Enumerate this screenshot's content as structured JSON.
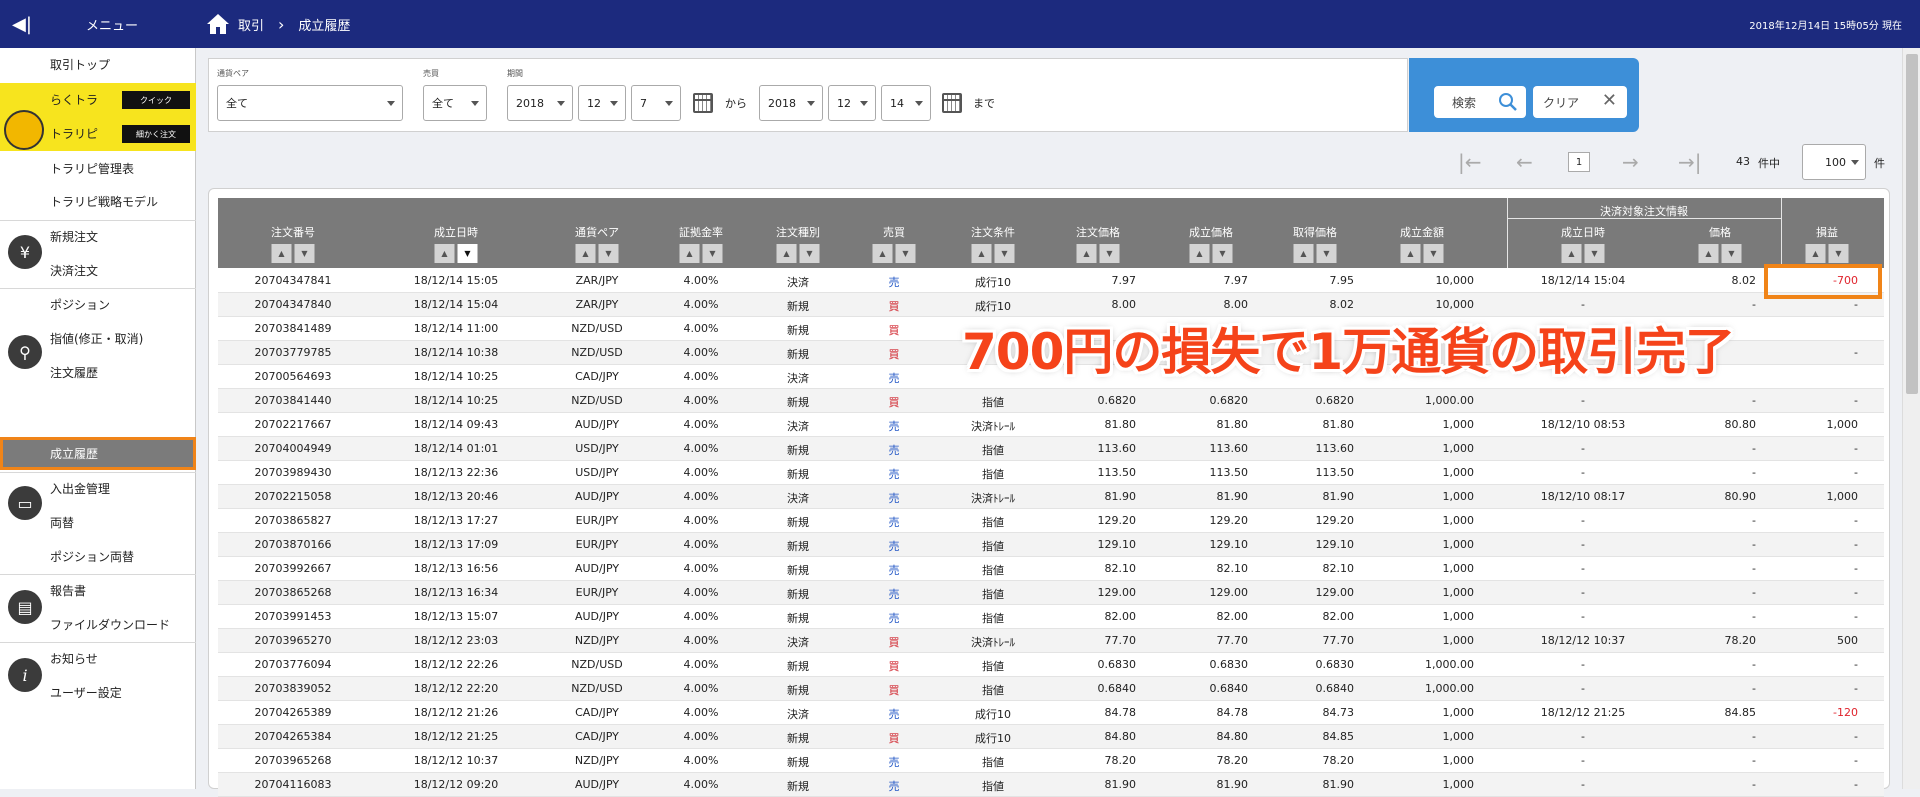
{
  "topbar": {
    "menu_label": "メニュー",
    "crumb_1": "取引",
    "crumb_2": "成立履歴",
    "datetime": "2018年12月14日 15時05分 現在"
  },
  "sidebar": {
    "top": "取引トップ",
    "rakutora": "らくトラ",
    "rakutora_badge": "クイック",
    "torarepi": "トラリピ",
    "torarepi_badge": "細かく注文",
    "torarepi_manage": "トラリピ管理表",
    "torarepi_strategy": "トラリピ戦略モデル",
    "new_order": "新規注文",
    "settle_order": "決済注文",
    "position": "ポジション",
    "limit_order": "指値(修正・取消)",
    "order_history": "注文履歴",
    "trade_history": "成立履歴",
    "deposit": "入出金管理",
    "exchange": "両替",
    "position_exchange": "ポジション両替",
    "report": "報告書",
    "download": "ファイルダウンロード",
    "notice": "お知らせ",
    "user_settings": "ユーザー設定"
  },
  "filter": {
    "pair_label": "通貨ペア",
    "pair_value": "全て",
    "side_label": "売買",
    "side_value": "全て",
    "period_label": "期間",
    "from_year": "2018",
    "from_month": "12",
    "from_day": "7",
    "from_text": "から",
    "to_year": "2018",
    "to_month": "12",
    "to_day": "14",
    "to_text": "まで",
    "search_label": "検索",
    "clear_label": "クリア"
  },
  "pager": {
    "page": "1",
    "count": "43",
    "count_suffix": "件中",
    "page_size": "100",
    "page_size_suffix": "件"
  },
  "table": {
    "group_header": "決済対象注文情報",
    "headers": {
      "order_no": "注文番号",
      "date": "成立日時",
      "pair": "通貨ペア",
      "margin": "証拠金率",
      "type": "注文種別",
      "side": "売買",
      "cond": "注文条件",
      "order_price": "注文価格",
      "exec_price": "成立価格",
      "fill_price": "取得価格",
      "amount": "成立金額",
      "settle_date": "成立日時",
      "settle_price": "価格",
      "pnl": "損益"
    },
    "rows": [
      {
        "no": "20704347841",
        "date": "18/12/14 15:05",
        "pair": "ZAR/JPY",
        "margin": "4.00%",
        "type": "決済",
        "side": "売",
        "cond": "成行10",
        "op": "7.97",
        "ep": "7.97",
        "fp": "7.95",
        "amt": "10,000",
        "sd": "18/12/14 15:04",
        "sp": "8.02",
        "pnl": "-700"
      },
      {
        "no": "20704347840",
        "date": "18/12/14 15:04",
        "pair": "ZAR/JPY",
        "margin": "4.00%",
        "type": "新規",
        "side": "買",
        "cond": "成行10",
        "op": "8.00",
        "ep": "8.00",
        "fp": "8.02",
        "amt": "10,000",
        "sd": "-",
        "sp": "-",
        "pnl": "-"
      },
      {
        "no": "20703841489",
        "date": "18/12/14 11:00",
        "pair": "NZD/USD",
        "margin": "4.00%",
        "type": "新規",
        "side": "買",
        "cond": "",
        "op": "",
        "ep": "",
        "fp": "",
        "amt": "",
        "sd": "",
        "sp": "",
        "pnl": ""
      },
      {
        "no": "20703779785",
        "date": "18/12/14 10:38",
        "pair": "NZD/USD",
        "margin": "4.00%",
        "type": "新規",
        "side": "買",
        "cond": "",
        "op": "",
        "ep": "",
        "fp": "",
        "amt": "",
        "sd": "",
        "sp": "",
        "pnl": "-"
      },
      {
        "no": "20700564693",
        "date": "18/12/14 10:25",
        "pair": "CAD/JPY",
        "margin": "4.00%",
        "type": "決済",
        "side": "売",
        "cond": "",
        "op": "",
        "ep": "",
        "fp": "",
        "amt": "",
        "sd": "",
        "sp": "",
        "pnl": ""
      },
      {
        "no": "20703841440",
        "date": "18/12/14 10:25",
        "pair": "NZD/USD",
        "margin": "4.00%",
        "type": "新規",
        "side": "買",
        "cond": "指値",
        "op": "0.6820",
        "ep": "0.6820",
        "fp": "0.6820",
        "amt": "1,000.00",
        "sd": "-",
        "sp": "-",
        "pnl": "-"
      },
      {
        "no": "20702217667",
        "date": "18/12/14 09:43",
        "pair": "AUD/JPY",
        "margin": "4.00%",
        "type": "決済",
        "side": "売",
        "cond": "決済ﾄﾚｰﾙ",
        "op": "81.80",
        "ep": "81.80",
        "fp": "81.80",
        "amt": "1,000",
        "sd": "18/12/10 08:53",
        "sp": "80.80",
        "pnl": "1,000"
      },
      {
        "no": "20704004949",
        "date": "18/12/14 01:01",
        "pair": "USD/JPY",
        "margin": "4.00%",
        "type": "新規",
        "side": "売",
        "cond": "指値",
        "op": "113.60",
        "ep": "113.60",
        "fp": "113.60",
        "amt": "1,000",
        "sd": "-",
        "sp": "-",
        "pnl": "-"
      },
      {
        "no": "20703989430",
        "date": "18/12/13 22:36",
        "pair": "USD/JPY",
        "margin": "4.00%",
        "type": "新規",
        "side": "売",
        "cond": "指値",
        "op": "113.50",
        "ep": "113.50",
        "fp": "113.50",
        "amt": "1,000",
        "sd": "-",
        "sp": "-",
        "pnl": "-"
      },
      {
        "no": "20702215058",
        "date": "18/12/13 20:46",
        "pair": "AUD/JPY",
        "margin": "4.00%",
        "type": "決済",
        "side": "売",
        "cond": "決済ﾄﾚｰﾙ",
        "op": "81.90",
        "ep": "81.90",
        "fp": "81.90",
        "amt": "1,000",
        "sd": "18/12/10 08:17",
        "sp": "80.90",
        "pnl": "1,000"
      },
      {
        "no": "20703865827",
        "date": "18/12/13 17:27",
        "pair": "EUR/JPY",
        "margin": "4.00%",
        "type": "新規",
        "side": "売",
        "cond": "指値",
        "op": "129.20",
        "ep": "129.20",
        "fp": "129.20",
        "amt": "1,000",
        "sd": "-",
        "sp": "-",
        "pnl": "-"
      },
      {
        "no": "20703870166",
        "date": "18/12/13 17:09",
        "pair": "EUR/JPY",
        "margin": "4.00%",
        "type": "新規",
        "side": "売",
        "cond": "指値",
        "op": "129.10",
        "ep": "129.10",
        "fp": "129.10",
        "amt": "1,000",
        "sd": "-",
        "sp": "-",
        "pnl": "-"
      },
      {
        "no": "20703992667",
        "date": "18/12/13 16:56",
        "pair": "AUD/JPY",
        "margin": "4.00%",
        "type": "新規",
        "side": "売",
        "cond": "指値",
        "op": "82.10",
        "ep": "82.10",
        "fp": "82.10",
        "amt": "1,000",
        "sd": "-",
        "sp": "-",
        "pnl": "-"
      },
      {
        "no": "20703865268",
        "date": "18/12/13 16:34",
        "pair": "EUR/JPY",
        "margin": "4.00%",
        "type": "新規",
        "side": "売",
        "cond": "指値",
        "op": "129.00",
        "ep": "129.00",
        "fp": "129.00",
        "amt": "1,000",
        "sd": "-",
        "sp": "-",
        "pnl": "-"
      },
      {
        "no": "20703991453",
        "date": "18/12/13 15:07",
        "pair": "AUD/JPY",
        "margin": "4.00%",
        "type": "新規",
        "side": "売",
        "cond": "指値",
        "op": "82.00",
        "ep": "82.00",
        "fp": "82.00",
        "amt": "1,000",
        "sd": "-",
        "sp": "-",
        "pnl": "-"
      },
      {
        "no": "20703965270",
        "date": "18/12/12 23:03",
        "pair": "NZD/JPY",
        "margin": "4.00%",
        "type": "決済",
        "side": "買",
        "cond": "決済ﾄﾚｰﾙ",
        "op": "77.70",
        "ep": "77.70",
        "fp": "77.70",
        "amt": "1,000",
        "sd": "18/12/12 10:37",
        "sp": "78.20",
        "pnl": "500"
      },
      {
        "no": "20703776094",
        "date": "18/12/12 22:26",
        "pair": "NZD/USD",
        "margin": "4.00%",
        "type": "新規",
        "side": "買",
        "cond": "指値",
        "op": "0.6830",
        "ep": "0.6830",
        "fp": "0.6830",
        "amt": "1,000.00",
        "sd": "-",
        "sp": "-",
        "pnl": "-"
      },
      {
        "no": "20703839052",
        "date": "18/12/12 22:20",
        "pair": "NZD/USD",
        "margin": "4.00%",
        "type": "新規",
        "side": "買",
        "cond": "指値",
        "op": "0.6840",
        "ep": "0.6840",
        "fp": "0.6840",
        "amt": "1,000.00",
        "sd": "-",
        "sp": "-",
        "pnl": "-"
      },
      {
        "no": "20704265389",
        "date": "18/12/12 21:26",
        "pair": "CAD/JPY",
        "margin": "4.00%",
        "type": "決済",
        "side": "売",
        "cond": "成行10",
        "op": "84.78",
        "ep": "84.78",
        "fp": "84.73",
        "amt": "1,000",
        "sd": "18/12/12 21:25",
        "sp": "84.85",
        "pnl": "-120"
      },
      {
        "no": "20704265384",
        "date": "18/12/12 21:25",
        "pair": "CAD/JPY",
        "margin": "4.00%",
        "type": "新規",
        "side": "買",
        "cond": "成行10",
        "op": "84.80",
        "ep": "84.80",
        "fp": "84.85",
        "amt": "1,000",
        "sd": "-",
        "sp": "-",
        "pnl": "-"
      },
      {
        "no": "20703965268",
        "date": "18/12/12 10:37",
        "pair": "NZD/JPY",
        "margin": "4.00%",
        "type": "新規",
        "side": "売",
        "cond": "指値",
        "op": "78.20",
        "ep": "78.20",
        "fp": "78.20",
        "amt": "1,000",
        "sd": "-",
        "sp": "-",
        "pnl": "-"
      },
      {
        "no": "20704116083",
        "date": "18/12/12 09:20",
        "pair": "AUD/JPY",
        "margin": "4.00%",
        "type": "新規",
        "side": "売",
        "cond": "指値",
        "op": "81.90",
        "ep": "81.90",
        "fp": "81.90",
        "amt": "1,000",
        "sd": "-",
        "sp": "-",
        "pnl": "-"
      }
    ]
  },
  "annotation": "700円の損失で1万通貨の取引完了"
}
